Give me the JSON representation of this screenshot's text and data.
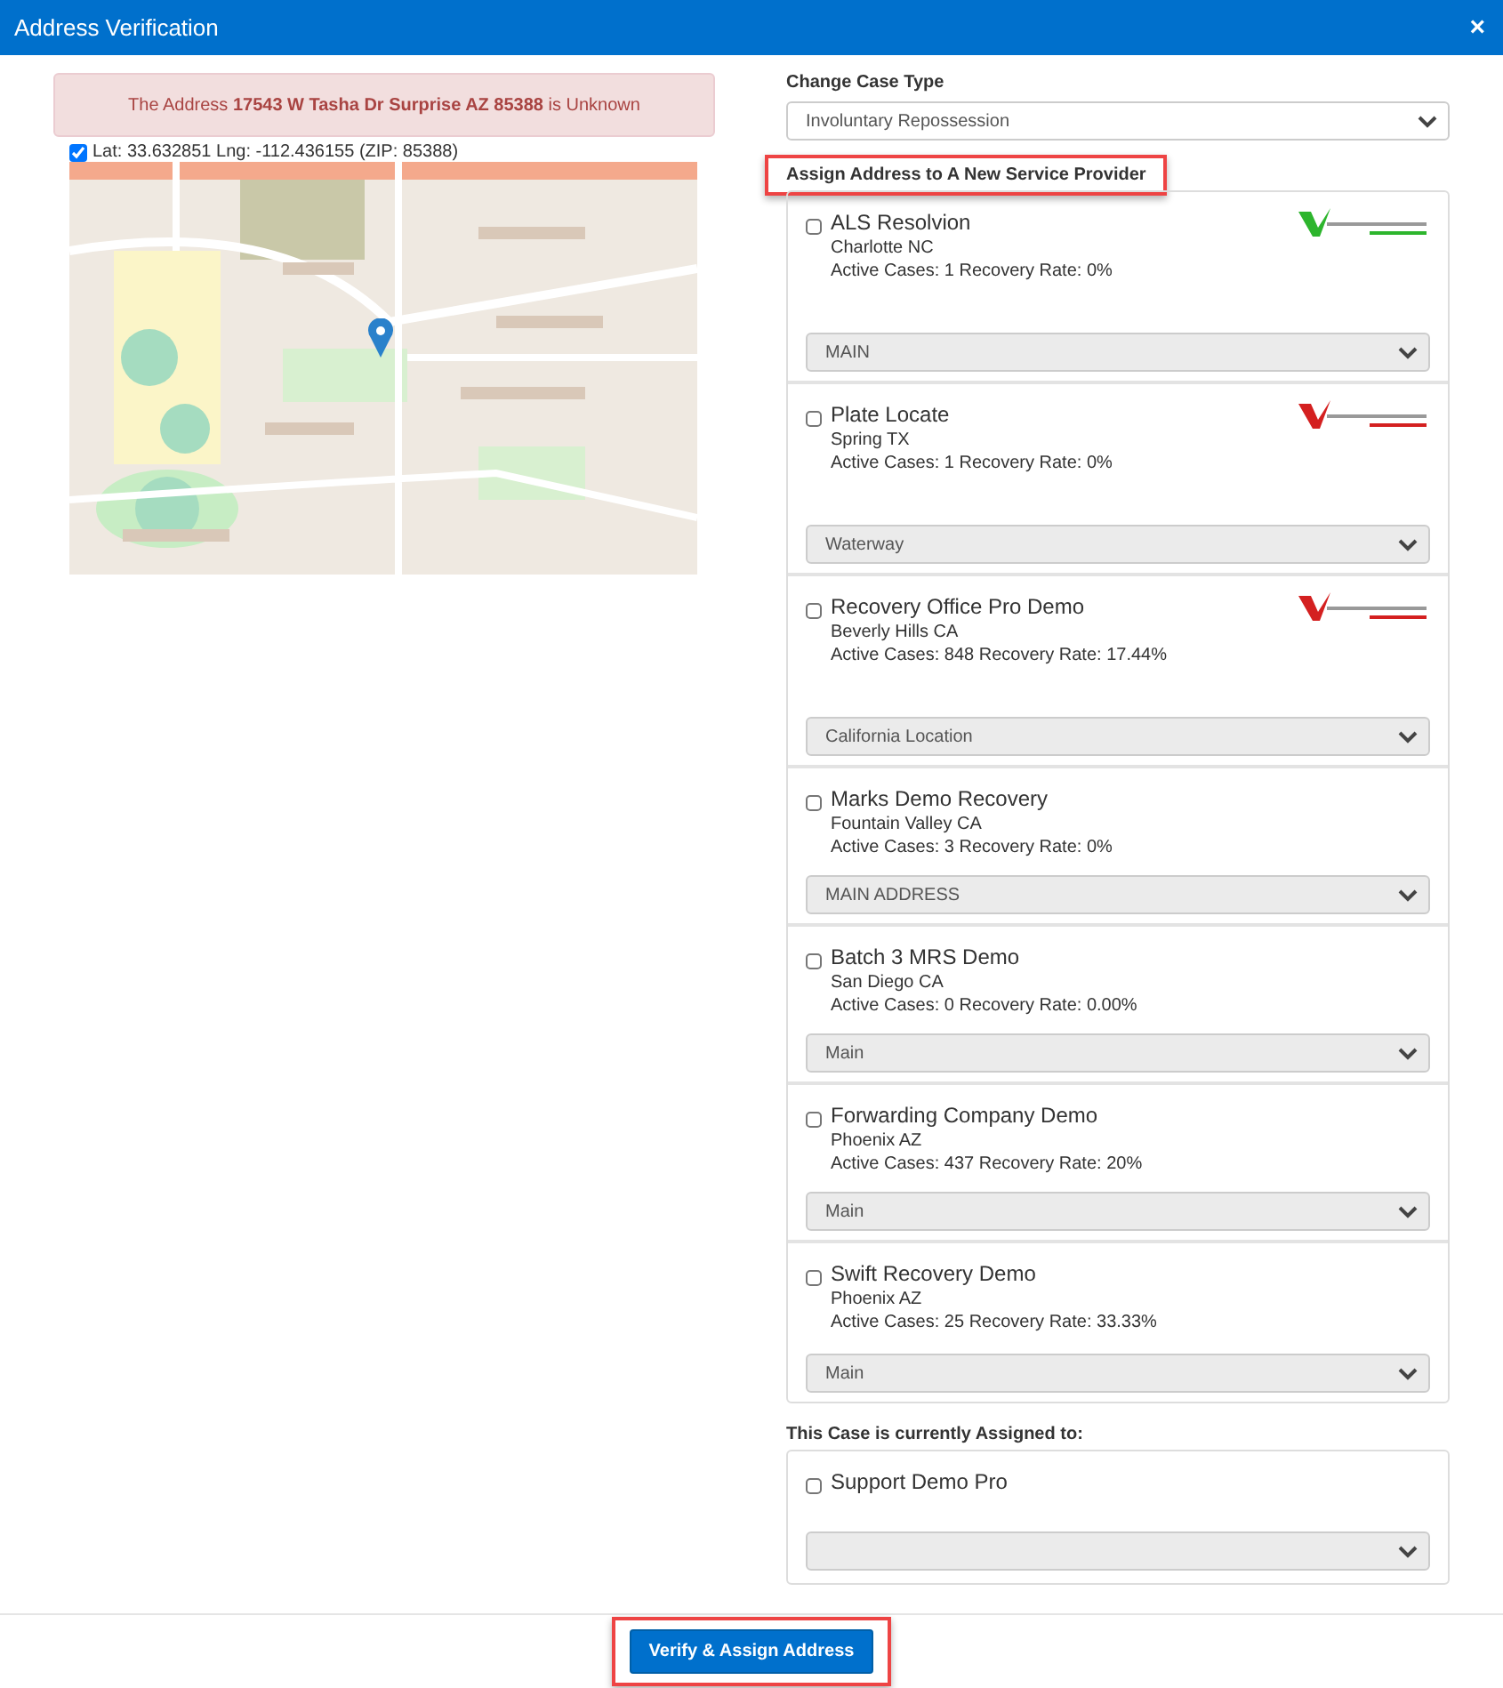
{
  "window": {
    "title": "Address Verification",
    "close": "×"
  },
  "alert": {
    "text": "The Address **17543 W Tasha Dr Surprise AZ 85388** is Unknown"
  },
  "coordinates": {
    "checked": true,
    "text": "Lat: 33.632851 Lng: -112.436155 (ZIP: 85388)"
  },
  "case_type": {
    "label": "Change Case Type",
    "value": "Involuntary Repossession"
  },
  "providers_section": {
    "heading": "Assign Address to A New Service Provider",
    "highlighted": true
  },
  "providers": [
    {
      "name": "ALS Resolvion",
      "location": "Charlotte NC",
      "stats": "Active Cases: 1 Recovery Rate: 0%",
      "checked": false,
      "logo": {
        "color": "#2db52d"
      },
      "branch": "MAIN"
    },
    {
      "name": "Plate Locate",
      "location": "Spring TX",
      "stats": "Active Cases: 1 Recovery Rate: 0%",
      "checked": false,
      "logo": {
        "color": "#d42020"
      },
      "branch": "Waterway"
    },
    {
      "name": "Recovery Office Pro Demo",
      "location": "Beverly Hills CA",
      "stats": "Active Cases: 848 Recovery Rate: 17.44%",
      "checked": false,
      "logo": {
        "color": "#d42020"
      },
      "branch": "California Location"
    },
    {
      "name": "Marks Demo Recovery",
      "location": "Fountain Valley CA",
      "stats": "Active Cases: 3 Recovery Rate: 0%",
      "checked": false,
      "branch": "MAIN ADDRESS"
    },
    {
      "name": "Batch 3 MRS Demo",
      "location": "San Diego CA",
      "stats": "Active Cases: 0 Recovery Rate: 0.00%",
      "checked": false,
      "branch": "Main"
    },
    {
      "name": "Forwarding Company Demo",
      "location": "Phoenix AZ",
      "stats": "Active Cases: 437 Recovery Rate: 20%",
      "checked": false,
      "branch": "Main"
    },
    {
      "name": "Swift Recovery Demo",
      "location": "Phoenix AZ",
      "stats": "Active Cases: 25 Recovery Rate: 33.33%",
      "checked": false,
      "branch": "Main"
    }
  ],
  "current": {
    "heading": "This Case is currently Assigned to:",
    "name": "Support Demo Pro",
    "checked": false
  },
  "footer": {
    "button": "Verify & Assign Address",
    "highlighted": true
  }
}
